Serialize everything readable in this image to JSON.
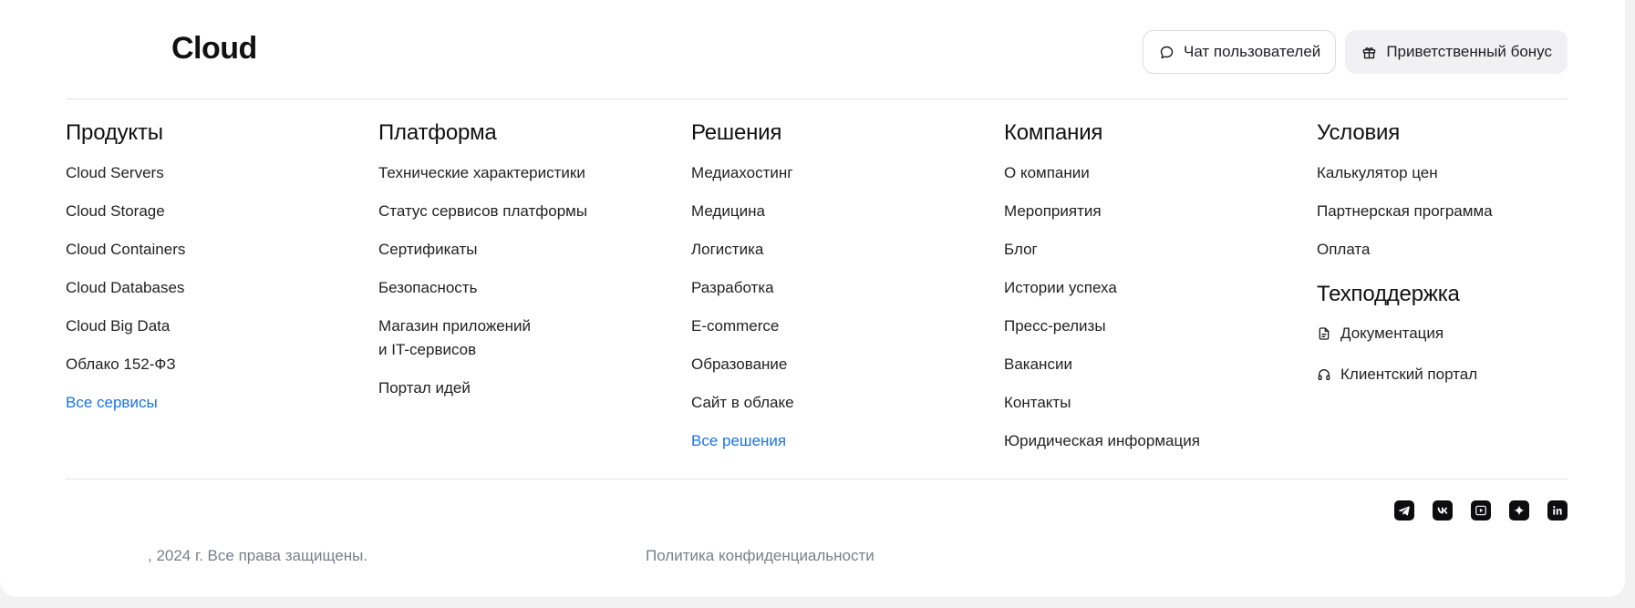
{
  "header": {
    "logo": "Cloud",
    "chat_button": "Чат пользователей",
    "bonus_button": "Приветственный бонус"
  },
  "columns": {
    "products": {
      "title": "Продукты",
      "items": [
        "Cloud Servers",
        "Cloud Storage",
        "Cloud Containers",
        "Cloud Databases",
        "Cloud Big Data",
        "Облако 152-ФЗ"
      ],
      "all_link": "Все сервисы"
    },
    "platform": {
      "title": "Платформа",
      "items": [
        "Технические характеристики",
        "Статус сервисов платформы",
        "Сертификаты",
        "Безопасность",
        "Магазин приложений",
        "и IT-сервисов",
        "Портал идей"
      ]
    },
    "solutions": {
      "title": "Решения",
      "items": [
        "Медиахостинг",
        "Медицина",
        "Логистика",
        "Разработка",
        "E-commerce",
        "Образование",
        "Сайт в облаке"
      ],
      "all_link": "Все решения"
    },
    "company": {
      "title": "Компания",
      "items": [
        "О компании",
        "Мероприятия",
        "Блог",
        "Истории успеха",
        "Пресс-релизы",
        "Вакансии",
        "Контакты",
        "Юридическая информация"
      ]
    },
    "terms": {
      "title": "Условия",
      "items": [
        "Калькулятор цен",
        "Партнерская программа",
        "Оплата"
      ]
    },
    "support": {
      "title": "Техподдержка",
      "items": [
        "Документация",
        "Клиентский портал"
      ]
    }
  },
  "footer": {
    "copyright": ", 2024 г. Все права защищены.",
    "privacy": "Политика конфиденциальности",
    "socials": [
      "telegram-icon",
      "vk-icon",
      "video-icon",
      "dzen-icon",
      "linkedin-icon"
    ]
  }
}
